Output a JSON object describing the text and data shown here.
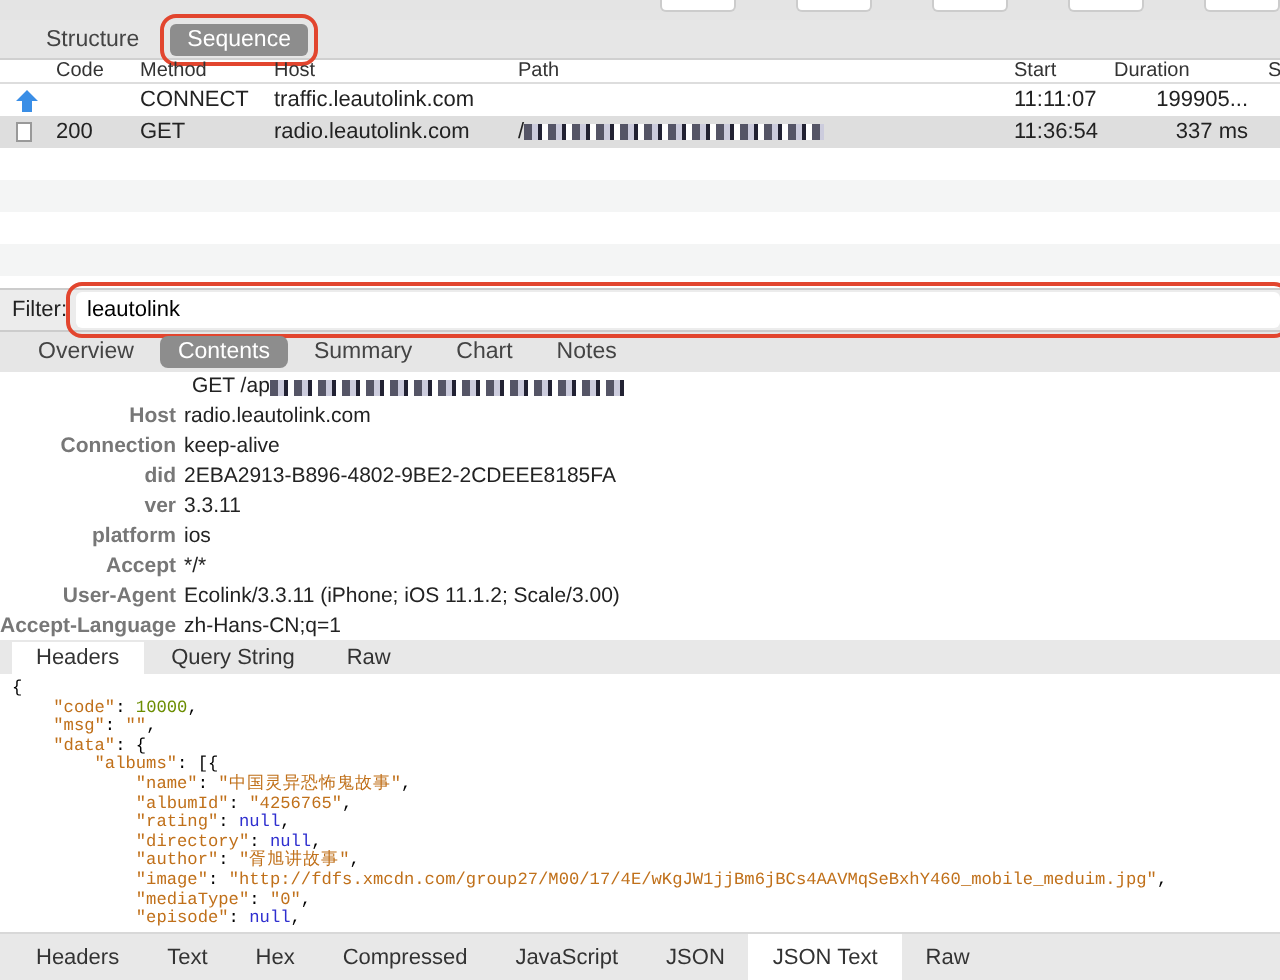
{
  "view_tabs": [
    {
      "label": "Structure",
      "selected": false
    },
    {
      "label": "Sequence",
      "selected": true,
      "highlighted": true
    }
  ],
  "table": {
    "columns": [
      "Code",
      "Method",
      "Host",
      "Path",
      "Start",
      "Duration",
      "S"
    ],
    "rows": [
      {
        "kind": "upload",
        "code": "",
        "method": "CONNECT",
        "host": "traffic.leautolink.com",
        "path": "",
        "path_redacted": false,
        "start": "11:11:07",
        "duration": "199905...",
        "selected": false
      },
      {
        "kind": "document",
        "code": "200",
        "method": "GET",
        "host": "radio.leautolink.com",
        "path": "/",
        "path_redacted": true,
        "start": "11:36:54",
        "duration": "337 ms",
        "selected": true
      }
    ]
  },
  "filter": {
    "label": "Filter:",
    "value": "leautolink",
    "highlighted": true
  },
  "detail_tabs": [
    {
      "label": "Overview",
      "selected": false
    },
    {
      "label": "Contents",
      "selected": true
    },
    {
      "label": "Summary",
      "selected": false
    },
    {
      "label": "Chart",
      "selected": false
    },
    {
      "label": "Notes",
      "selected": false
    }
  ],
  "request_line": {
    "text": "GET /ap",
    "redacted": true
  },
  "headers": [
    {
      "name": "Host",
      "value": "radio.leautolink.com"
    },
    {
      "name": "Connection",
      "value": "keep-alive"
    },
    {
      "name": "did",
      "value": "2EBA2913-B896-4802-9BE2-2CDEEE8185FA"
    },
    {
      "name": "ver",
      "value": "3.3.11"
    },
    {
      "name": "platform",
      "value": "ios"
    },
    {
      "name": "Accept",
      "value": "*/*"
    },
    {
      "name": "User-Agent",
      "value": "Ecolink/3.3.11 (iPhone; iOS 11.1.2; Scale/3.00)"
    },
    {
      "name": "Accept-Language",
      "value": "zh-Hans-CN;q=1"
    }
  ],
  "request_tabs": [
    {
      "label": "Headers",
      "selected": true
    },
    {
      "label": "Query String",
      "selected": false
    },
    {
      "label": "Raw",
      "selected": false
    }
  ],
  "code_lines": [
    {
      "tokens": [
        {
          "kind": "punct",
          "text": "{"
        }
      ],
      "children": [
        {
          "tokens": [
            {
              "kind": "key",
              "text": "\"code\""
            },
            {
              "kind": "punct",
              "text": ": "
            },
            {
              "kind": "number",
              "text": "10000"
            },
            {
              "kind": "punct",
              "text": ","
            }
          ]
        },
        {
          "tokens": [
            {
              "kind": "key",
              "text": "\"msg\""
            },
            {
              "kind": "punct",
              "text": ": "
            },
            {
              "kind": "string",
              "text": "\"\""
            },
            {
              "kind": "punct",
              "text": ","
            }
          ]
        },
        {
          "tokens": [
            {
              "kind": "key",
              "text": "\"data\""
            },
            {
              "kind": "punct",
              "text": ": {"
            }
          ],
          "children": [
            {
              "tokens": [
                {
                  "kind": "key",
                  "text": "\"albums\""
                },
                {
                  "kind": "punct",
                  "text": ": [{"
                }
              ],
              "children": [
                {
                  "tokens": [
                    {
                      "kind": "key",
                      "text": "\"name\""
                    },
                    {
                      "kind": "punct",
                      "text": ": "
                    },
                    {
                      "kind": "string",
                      "text": "\"中国灵异恐怖鬼故事\""
                    },
                    {
                      "kind": "punct",
                      "text": ","
                    }
                  ]
                },
                {
                  "tokens": [
                    {
                      "kind": "key",
                      "text": "\"albumId\""
                    },
                    {
                      "kind": "punct",
                      "text": ": "
                    },
                    {
                      "kind": "string",
                      "text": "\"4256765\""
                    },
                    {
                      "kind": "punct",
                      "text": ","
                    }
                  ]
                },
                {
                  "tokens": [
                    {
                      "kind": "key",
                      "text": "\"rating\""
                    },
                    {
                      "kind": "punct",
                      "text": ": "
                    },
                    {
                      "kind": "null",
                      "text": "null"
                    },
                    {
                      "kind": "punct",
                      "text": ","
                    }
                  ]
                },
                {
                  "tokens": [
                    {
                      "kind": "key",
                      "text": "\"directory\""
                    },
                    {
                      "kind": "punct",
                      "text": ": "
                    },
                    {
                      "kind": "null",
                      "text": "null"
                    },
                    {
                      "kind": "punct",
                      "text": ","
                    }
                  ]
                },
                {
                  "tokens": [
                    {
                      "kind": "key",
                      "text": "\"author\""
                    },
                    {
                      "kind": "punct",
                      "text": ": "
                    },
                    {
                      "kind": "string",
                      "text": "\"胥旭讲故事\""
                    },
                    {
                      "kind": "punct",
                      "text": ","
                    }
                  ]
                },
                {
                  "tokens": [
                    {
                      "kind": "key",
                      "text": "\"image\""
                    },
                    {
                      "kind": "punct",
                      "text": ": "
                    },
                    {
                      "kind": "string",
                      "text": "\"http://fdfs.xmcdn.com/group27/M00/17/4E/wKgJW1jjBm6jBCs4AAVMqSeBxhY460_mobile_meduim.jpg\""
                    },
                    {
                      "kind": "punct",
                      "text": ","
                    }
                  ]
                },
                {
                  "tokens": [
                    {
                      "kind": "key",
                      "text": "\"mediaType\""
                    },
                    {
                      "kind": "punct",
                      "text": ": "
                    },
                    {
                      "kind": "string",
                      "text": "\"0\""
                    },
                    {
                      "kind": "punct",
                      "text": ","
                    }
                  ]
                },
                {
                  "tokens": [
                    {
                      "kind": "key",
                      "text": "\"episode\""
                    },
                    {
                      "kind": "punct",
                      "text": ": "
                    },
                    {
                      "kind": "null",
                      "text": "null"
                    },
                    {
                      "kind": "punct",
                      "text": ","
                    }
                  ]
                }
              ]
            }
          ]
        }
      ]
    }
  ],
  "response_tabs": [
    {
      "label": "Headers",
      "selected": false
    },
    {
      "label": "Text",
      "selected": false
    },
    {
      "label": "Hex",
      "selected": false
    },
    {
      "label": "Compressed",
      "selected": false
    },
    {
      "label": "JavaScript",
      "selected": false
    },
    {
      "label": "JSON",
      "selected": false
    },
    {
      "label": "JSON Text",
      "selected": true
    },
    {
      "label": "Raw",
      "selected": false
    }
  ]
}
